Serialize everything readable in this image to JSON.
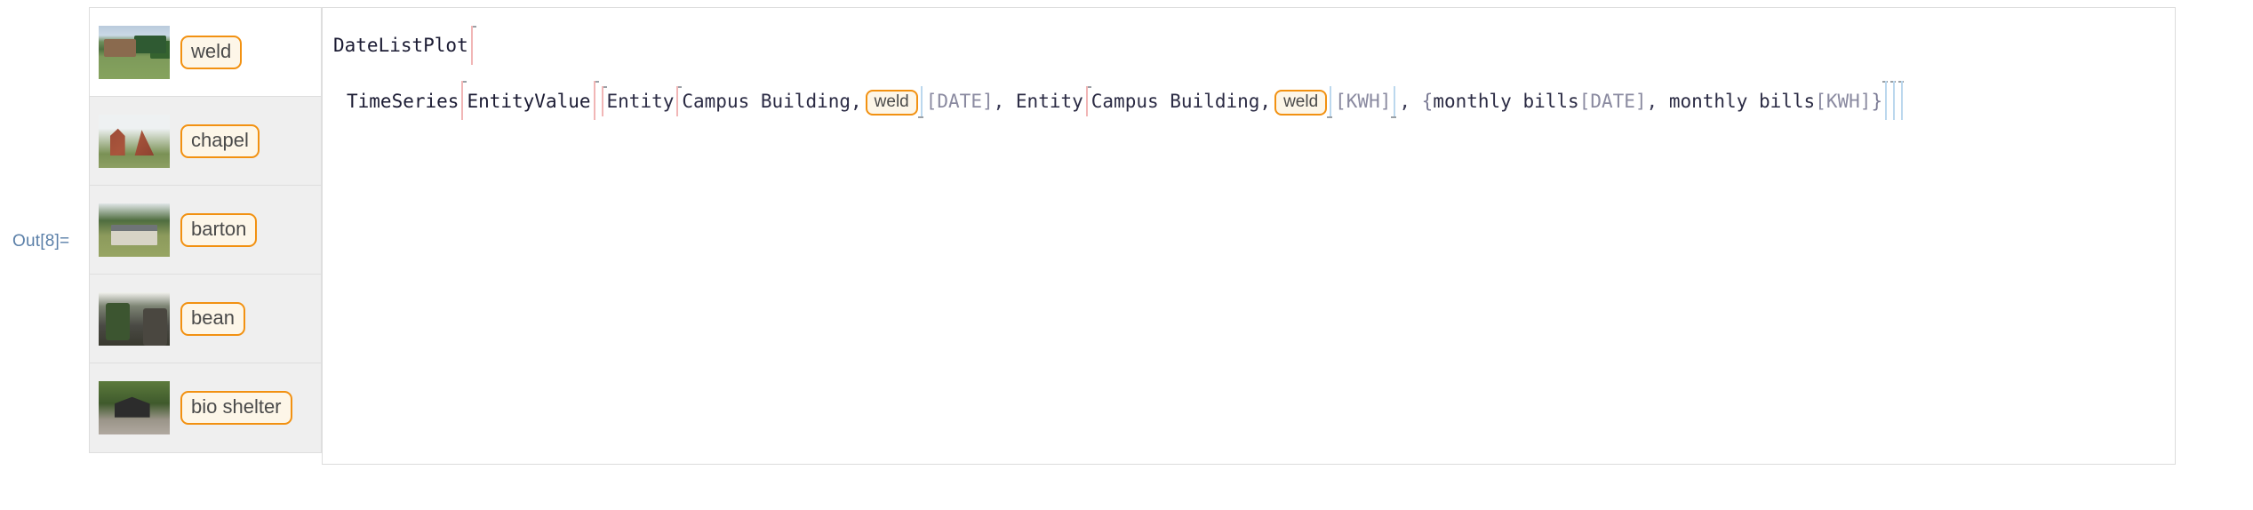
{
  "output_label": "Out[8]=",
  "accent_colors": {
    "pill_border": "#f29111",
    "pill_background": "#fdf6e8",
    "out_label": "#5a7fa8",
    "panel_border": "#dedede",
    "row_background": "#efefef",
    "row_selected_background": "#ffffff"
  },
  "entity_list": {
    "items": [
      {
        "label": "weld",
        "thumbnail": "campus-photo-weld",
        "selected": true
      },
      {
        "label": "chapel",
        "thumbnail": "campus-photo-chapel",
        "selected": false
      },
      {
        "label": "barton",
        "thumbnail": "campus-photo-barton",
        "selected": false
      },
      {
        "label": "bean",
        "thumbnail": "campus-photo-bean",
        "selected": false
      },
      {
        "label": "bio shelter",
        "thumbnail": "campus-photo-bioshelter",
        "selected": false
      }
    ]
  },
  "code": {
    "line1": {
      "function": "DateListPlot"
    },
    "line2": {
      "function": "TimeSeries",
      "inner_function": "EntityValue",
      "entity_type_1": "Campus Building,",
      "entity_name_1": "weld",
      "property_1": "[DATE]",
      "separator_1": ", ",
      "entity_keyword_1": "Entity",
      "entity_keyword_2": "Entity",
      "entity_type_2": "Campus Building,",
      "entity_name_2": "weld",
      "property_2": "[KWH]",
      "separator_2": ", ",
      "prop_list": "{monthly bills[DATE], monthly bills[KWH]}",
      "prop_list_open": "{",
      "prop_1": "monthly bills",
      "prop_1_arg": "[DATE]",
      "prop_sep": ", ",
      "prop_2": "monthly bills",
      "prop_2_arg": "[KWH]",
      "prop_list_close": "}"
    },
    "full_text": "DateListPlot[TimeSeries[EntityValue[{Entity[Campus Building, weld][DATE], Entity[Campus Building, weld][KWH]}, {monthly bills[DATE], monthly bills[KWH]}]]]"
  }
}
